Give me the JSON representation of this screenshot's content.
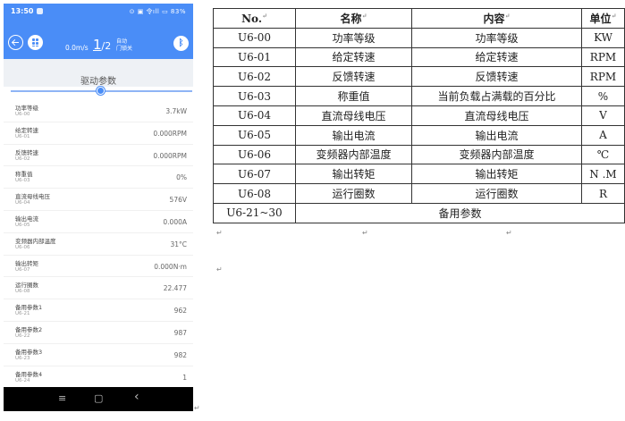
{
  "status_bar": {
    "time": "13:50",
    "right_text": "⊙ ▣ 令ıll ▭ 83%"
  },
  "header": {
    "speed": "0.0m/s",
    "page_current": "1",
    "page_total": "/2",
    "mode_line1": "自动",
    "mode_line2": "门锁关"
  },
  "page_title": "驱动参数",
  "slider": {
    "position": 0.5
  },
  "params": [
    {
      "name": "功率等级",
      "code": "U6-00",
      "value": "3.7kW"
    },
    {
      "name": "给定转速",
      "code": "U6-01",
      "value": "0.000RPM"
    },
    {
      "name": "反馈转速",
      "code": "U6-02",
      "value": "0.000RPM"
    },
    {
      "name": "称重值",
      "code": "U6-03",
      "value": "0%"
    },
    {
      "name": "直流母线电压",
      "code": "U6-04",
      "value": "576V"
    },
    {
      "name": "输出电流",
      "code": "U6-05",
      "value": "0.000A"
    },
    {
      "name": "变频器内部温度",
      "code": "U6-06",
      "value": "31°C"
    },
    {
      "name": "输出转矩",
      "code": "U6-07",
      "value": "0.000N·m"
    },
    {
      "name": "运行圈数",
      "code": "U6-08",
      "value": "22.477"
    },
    {
      "name": "备用参数1",
      "code": "U6-21",
      "value": "962"
    },
    {
      "name": "备用参数2",
      "code": "U6-22",
      "value": "987"
    },
    {
      "name": "备用参数3",
      "code": "U6-23",
      "value": "982"
    },
    {
      "name": "备用参数4",
      "code": "U6-24",
      "value": "1"
    }
  ],
  "navbar": {
    "menu": "≡",
    "home": "▢",
    "back": "‹"
  },
  "table": {
    "headers": [
      "No.",
      "名称",
      "内容",
      "单位"
    ],
    "rows": [
      [
        "U6-00",
        "功率等级",
        "功率等级",
        "KW"
      ],
      [
        "U6-01",
        "给定转速",
        "给定转速",
        "RPM"
      ],
      [
        "U6-02",
        "反馈转速",
        "反馈转速",
        "RPM"
      ],
      [
        "U6-03",
        "称重值",
        "当前负载占满载的百分比",
        "%"
      ],
      [
        "U6-04",
        "直流母线电压",
        "直流母线电压",
        "V"
      ],
      [
        "U6-05",
        "输出电流",
        "输出电流",
        "A"
      ],
      [
        "U6-06",
        "变频器内部温度",
        "变频器内部温度",
        "℃"
      ],
      [
        "U6-07",
        "输出转矩",
        "输出转矩",
        "N .M"
      ],
      [
        "U6-08",
        "运行圈数",
        "运行圈数",
        "R"
      ]
    ],
    "last_row": {
      "no": "U6-21~30",
      "span_text": "备用参数"
    }
  },
  "paragraph_mark": "↵",
  "colors": {
    "accent": "#4a8df7",
    "navbar": "#000000"
  }
}
